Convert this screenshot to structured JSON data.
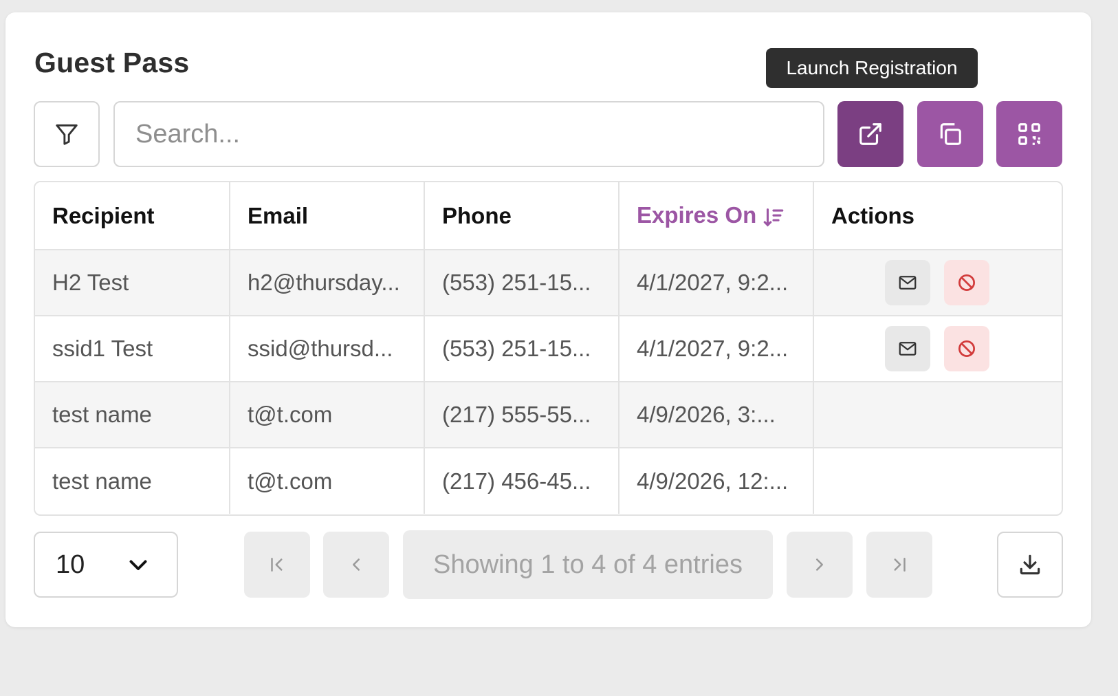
{
  "page": {
    "title": "Guest Pass"
  },
  "tooltip": {
    "text": "Launch Registration"
  },
  "toolbar": {
    "search_placeholder": "Search...",
    "filter_icon": "filter-icon",
    "launch_icon": "external-link-icon",
    "copy_icon": "copy-icon",
    "qr_icon": "qr-code-icon"
  },
  "table": {
    "headers": [
      "Recipient",
      "Email",
      "Phone",
      "Expires On",
      "Actions"
    ],
    "sorted_column": "Expires On",
    "sort_direction": "descending",
    "rows": [
      {
        "recipient": "H2 Test",
        "email": "h2@thursday...",
        "phone": "(553) 251-15...",
        "expires": "4/1/2027, 9:2...",
        "has_actions": true
      },
      {
        "recipient": "ssid1 Test",
        "email": "ssid@thursd...",
        "phone": "(553) 251-15...",
        "expires": "4/1/2027, 9:2...",
        "has_actions": true
      },
      {
        "recipient": "test name",
        "email": "t@t.com",
        "phone": "(217) 555-55...",
        "expires": "4/9/2026, 3:...",
        "has_actions": false
      },
      {
        "recipient": "test name",
        "email": "t@t.com",
        "phone": "(217) 456-45...",
        "expires": "4/9/2026, 12:...",
        "has_actions": false
      }
    ]
  },
  "pagination": {
    "per_page": "10",
    "info": "Showing 1 to 4 of 4 entries"
  },
  "colors": {
    "accent": "#9c56a4",
    "accent_dark": "#7b3f82",
    "revoke_bg": "#fbe2e2",
    "revoke_icon": "#d23c3c"
  }
}
